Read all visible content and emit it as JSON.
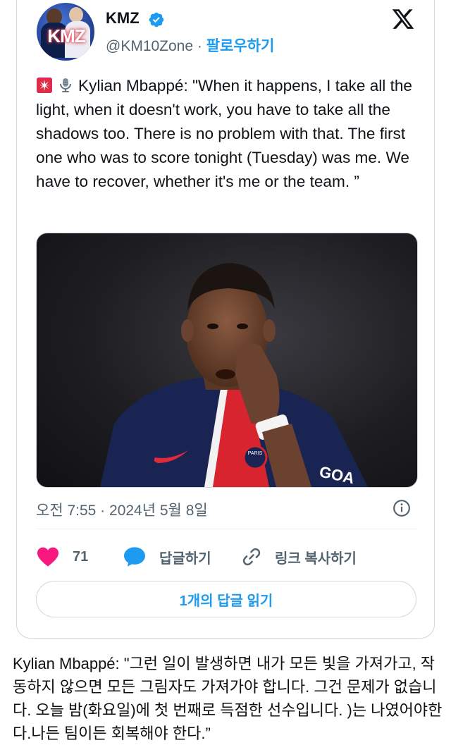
{
  "tweet": {
    "author_name": "KMZ",
    "handle": "@KM10Zone",
    "separator": " · ",
    "follow_label": "팔로우하기",
    "avatar_logo_text": "KMZ",
    "text": "Kylian Mbappé: \"When it happens, I take all the light, when it doesn't work, you have to take all the shadows too. There is no problem with that. The first one who was to score tonight (Tuesday) was me. We have to recover, whether it's me or the team. ”",
    "emojis": [
      "siren-emoji",
      "microphone-emoji"
    ],
    "photo_jersey_text": "GOA",
    "photo_badge_text": "PARIS",
    "timestamp": "오전 7:55 · 2024년 5월 8일",
    "like_count": "71",
    "reply_label": "답글하기",
    "copy_link_label": "링크 복사하기",
    "read_replies_label": "1개의 답글 읽기"
  },
  "translation": "Kylian Mbappé: \"그런 일이 발생하면 내가 모든 빛을 가져가고, 작동하지 않으면 모든 그림자도 가져가야 합니다. 그건 문제가 없습니다. 오늘 밤(화요일)에 첫 번째로 득점한 선수입니다. )는 나였어야한다.나든 팀이든 회복해야 한다.”",
  "colors": {
    "accent": "#1d9bf0",
    "like": "#f91880",
    "muted": "#536471",
    "border": "#cfd9de"
  }
}
